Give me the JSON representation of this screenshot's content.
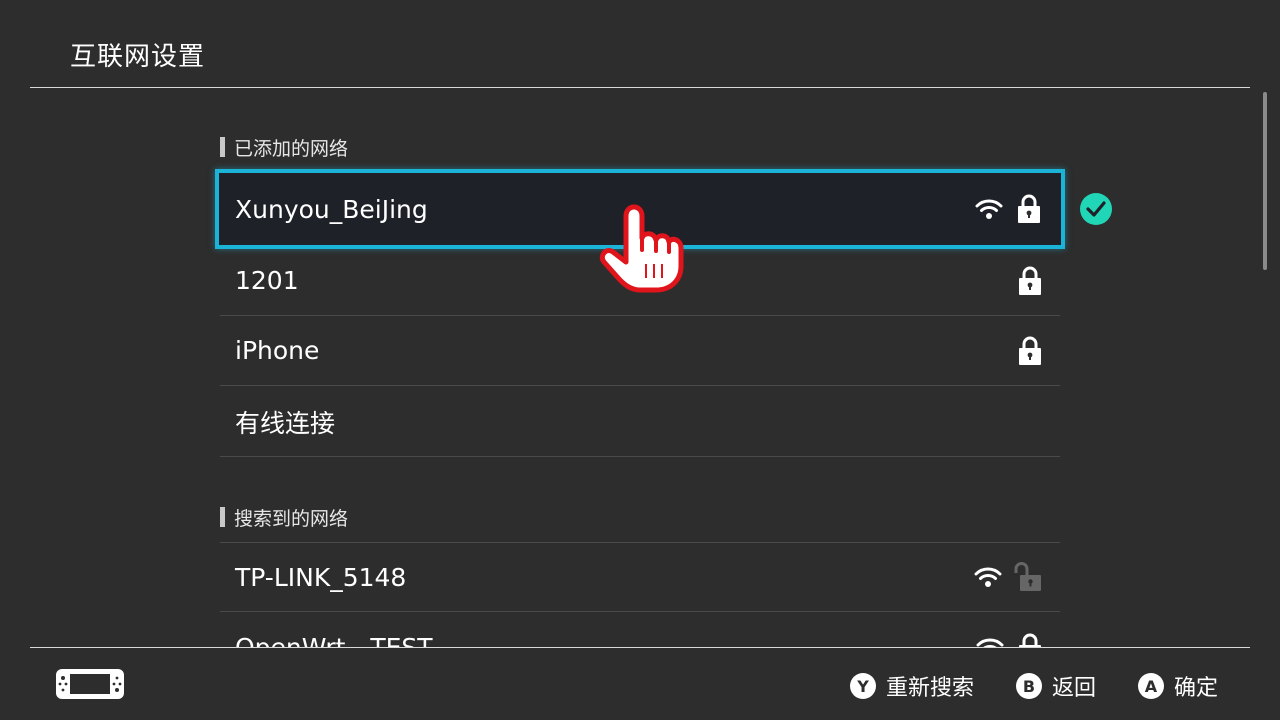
{
  "page": {
    "title": "互联网设置"
  },
  "added_networks": {
    "header": "已添加的网络",
    "items": [
      {
        "name": "Xunyou_BeiJing",
        "wifi": true,
        "lock": "locked",
        "selected": true,
        "connected": true
      },
      {
        "name": "1201",
        "wifi": false,
        "lock": "locked"
      },
      {
        "name": "iPhone",
        "wifi": false,
        "lock": "locked"
      },
      {
        "name": "有线连接",
        "wifi": false,
        "lock": "none"
      }
    ]
  },
  "found_networks": {
    "header": "搜索到的网络",
    "items": [
      {
        "name": "TP-LINK_5148",
        "wifi": true,
        "lock": "unlocked"
      },
      {
        "name": "OpenWrt - TEST",
        "wifi": true,
        "lock": "locked"
      }
    ]
  },
  "footer": {
    "buttons": [
      {
        "key": "Y",
        "label": "重新搜索"
      },
      {
        "key": "B",
        "label": "返回"
      },
      {
        "key": "A",
        "label": "确定"
      }
    ]
  },
  "colors": {
    "background": "#2d2d2d",
    "selection_border": "#1bb3d8",
    "connected_check": "#21d6b6",
    "pointer": "#e0141b"
  },
  "icons": {
    "wifi": "wifi-icon",
    "lock": "lock-icon",
    "unlock": "unlock-icon",
    "check": "check-icon",
    "pointer": "hand-pointer-icon",
    "console": "console-icon"
  }
}
